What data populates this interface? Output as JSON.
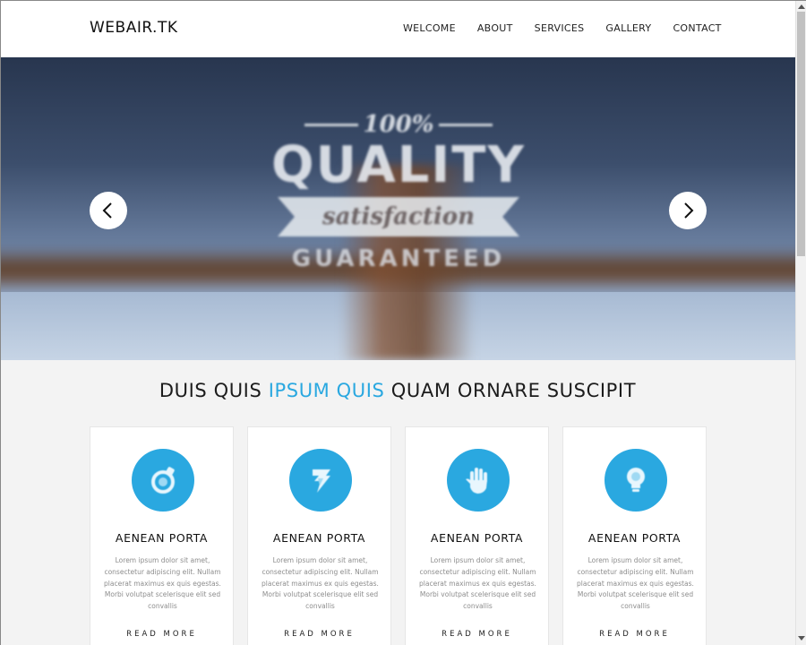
{
  "header": {
    "logo": "WEBAIR.TK",
    "nav": [
      "WELCOME",
      "ABOUT",
      "SERVICES",
      "GALLERY",
      "CONTACT"
    ]
  },
  "hero": {
    "badge_percent": "100%",
    "badge_quality": "QUALITY",
    "badge_ribbon": "satisfaction",
    "badge_guaranteed": "GUARANTEED",
    "prev_icon": "chevron-left-icon",
    "next_icon": "chevron-right-icon"
  },
  "features": {
    "title_part1": "DUIS QUIS",
    "title_highlight": "IPSUM QUIS",
    "title_part2": "QUAM ORNARE SUSCIPIT",
    "highlight_color": "#2aa8e0",
    "cards": [
      {
        "icon": "ring-icon",
        "title": "AENEAN PORTA",
        "text": "Lorem ipsum dolor sit amet, consectetur adipiscing elit. Nullam placerat maximus ex quis egestas. Morbi volutpat scelerisque elit sed convallis",
        "link": "READ MORE"
      },
      {
        "icon": "lightning-icon",
        "title": "AENEAN PORTA",
        "text": "Lorem ipsum dolor sit amet, consectetur adipiscing elit. Nullam placerat maximus ex quis egestas. Morbi volutpat scelerisque elit sed convallis",
        "link": "READ MORE"
      },
      {
        "icon": "hand-icon",
        "title": "AENEAN PORTA",
        "text": "Lorem ipsum dolor sit amet, consectetur adipiscing elit. Nullam placerat maximus ex quis egestas. Morbi volutpat scelerisque elit sed convallis",
        "link": "READ MORE"
      },
      {
        "icon": "lightbulb-icon",
        "title": "AENEAN PORTA",
        "text": "Lorem ipsum dolor sit amet, consectetur adipiscing elit. Nullam placerat maximus ex quis egestas. Morbi volutpat scelerisque elit sed convallis",
        "link": "READ MORE"
      }
    ]
  }
}
